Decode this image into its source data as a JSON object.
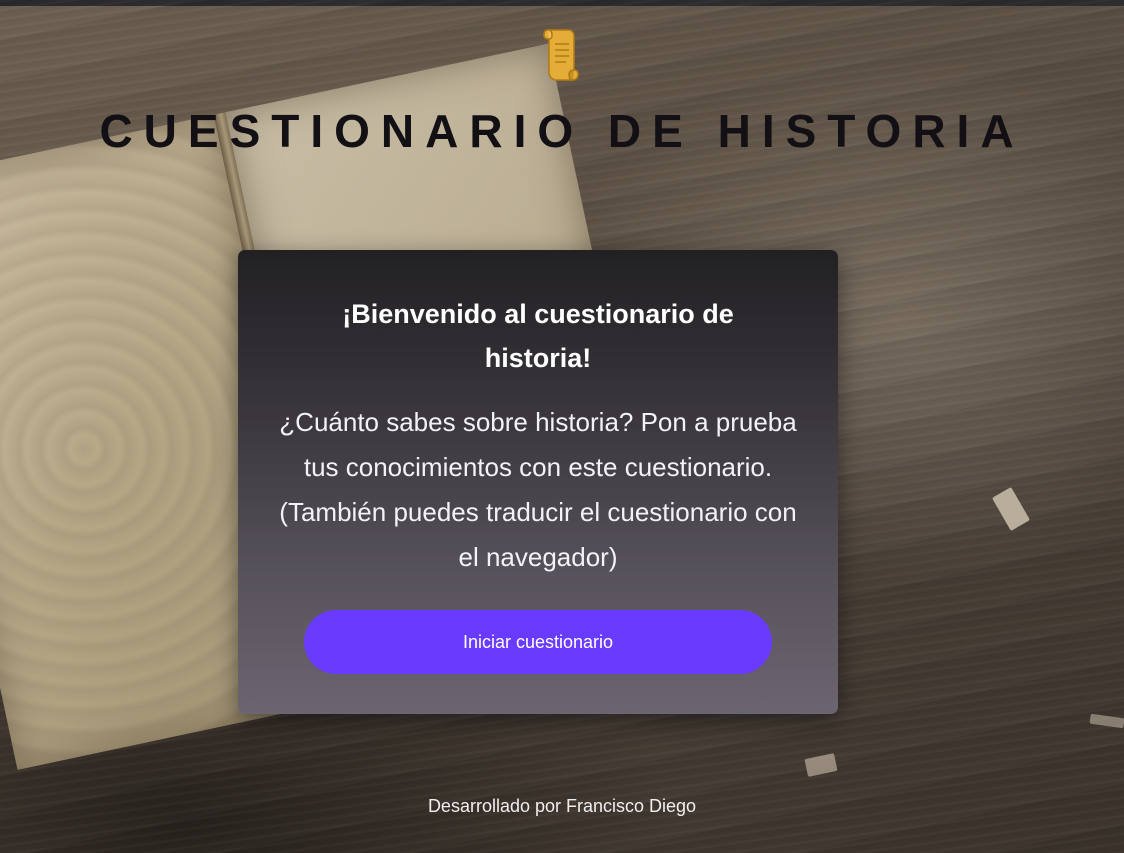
{
  "header": {
    "logo_icon": "scroll-icon",
    "title": "CUESTIONARIO DE HISTORIA"
  },
  "welcome_card": {
    "heading": "¡Bienvenido al cuestionario de historia!",
    "description": "¿Cuánto sabes sobre historia? Pon a prueba tus conocimientos con este cuestionario. (También puedes traducir el cuestionario con el navegador)",
    "start_button_label": "Iniciar cuestionario"
  },
  "footer": {
    "credit": "Desarrollado por Francisco Diego"
  },
  "colors": {
    "accent_button": "#6a3bff",
    "title_text": "#121014",
    "card_top": "#212023",
    "card_bottom": "#6b6571"
  }
}
